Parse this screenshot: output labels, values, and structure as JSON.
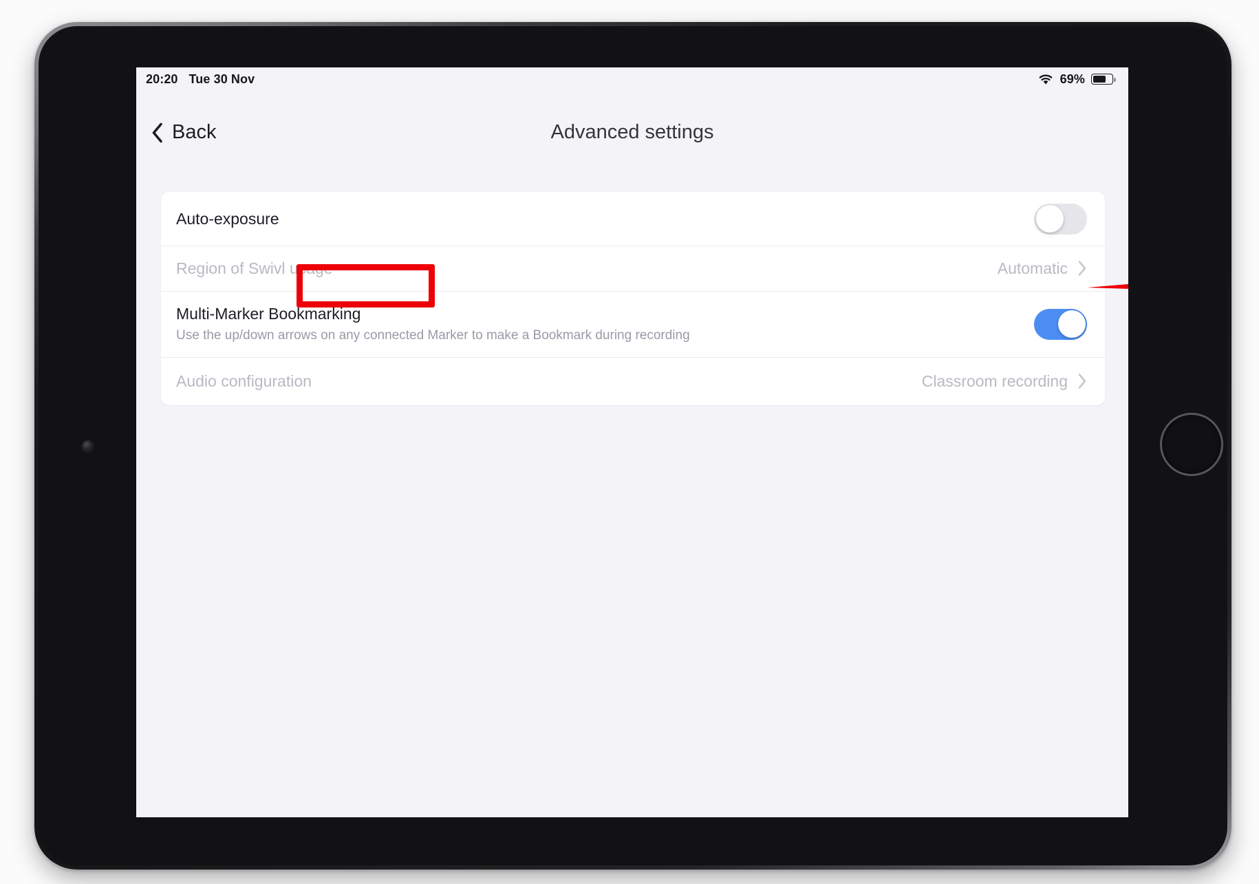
{
  "status_bar": {
    "time": "20:20",
    "date": "Tue 30 Nov",
    "wifi_icon": "wifi-icon",
    "battery_percent": "69%",
    "battery_level": 69,
    "battery_icon": "battery-icon"
  },
  "nav": {
    "back_label": "Back",
    "back_icon": "chevron-left-icon",
    "title": "Advanced settings"
  },
  "settings": {
    "rows": [
      {
        "name": "auto-exposure",
        "title": "Auto-exposure",
        "sub": "",
        "control": "toggle",
        "toggle_state": "off",
        "value": "",
        "dimmed": false,
        "highlighted": true
      },
      {
        "name": "region-of-swivl-usage",
        "title": "Region of Swivl usage",
        "sub": "",
        "control": "disclosure",
        "value": "Automatic",
        "dimmed": true,
        "highlighted": false
      },
      {
        "name": "multi-marker-bookmarking",
        "title": "Multi-Marker Bookmarking",
        "sub": "Use the up/down arrows on any connected Marker to make a Bookmark during recording",
        "control": "toggle",
        "toggle_state": "on",
        "value": "",
        "dimmed": false,
        "highlighted": false
      },
      {
        "name": "audio-configuration",
        "title": "Audio configuration",
        "sub": "",
        "control": "disclosure",
        "value": "Classroom recording",
        "dimmed": true,
        "highlighted": false
      }
    ]
  },
  "annotations": {
    "highlight_box_target": "Auto-exposure",
    "arrow_target": "auto-exposure-toggle",
    "color": "#ee0007"
  },
  "colors": {
    "toggle_on": "#4c8df2",
    "toggle_off": "#e6e6ea",
    "screen_background": "#f4f4f8",
    "card_background": "#ffffff",
    "dim_text": "#b9b9c2",
    "title_text": "#1d1d24",
    "annotation_red": "#ee0007"
  },
  "device": {
    "front_camera_icon": "camera-icon",
    "home_button_icon": "home-button-icon"
  }
}
